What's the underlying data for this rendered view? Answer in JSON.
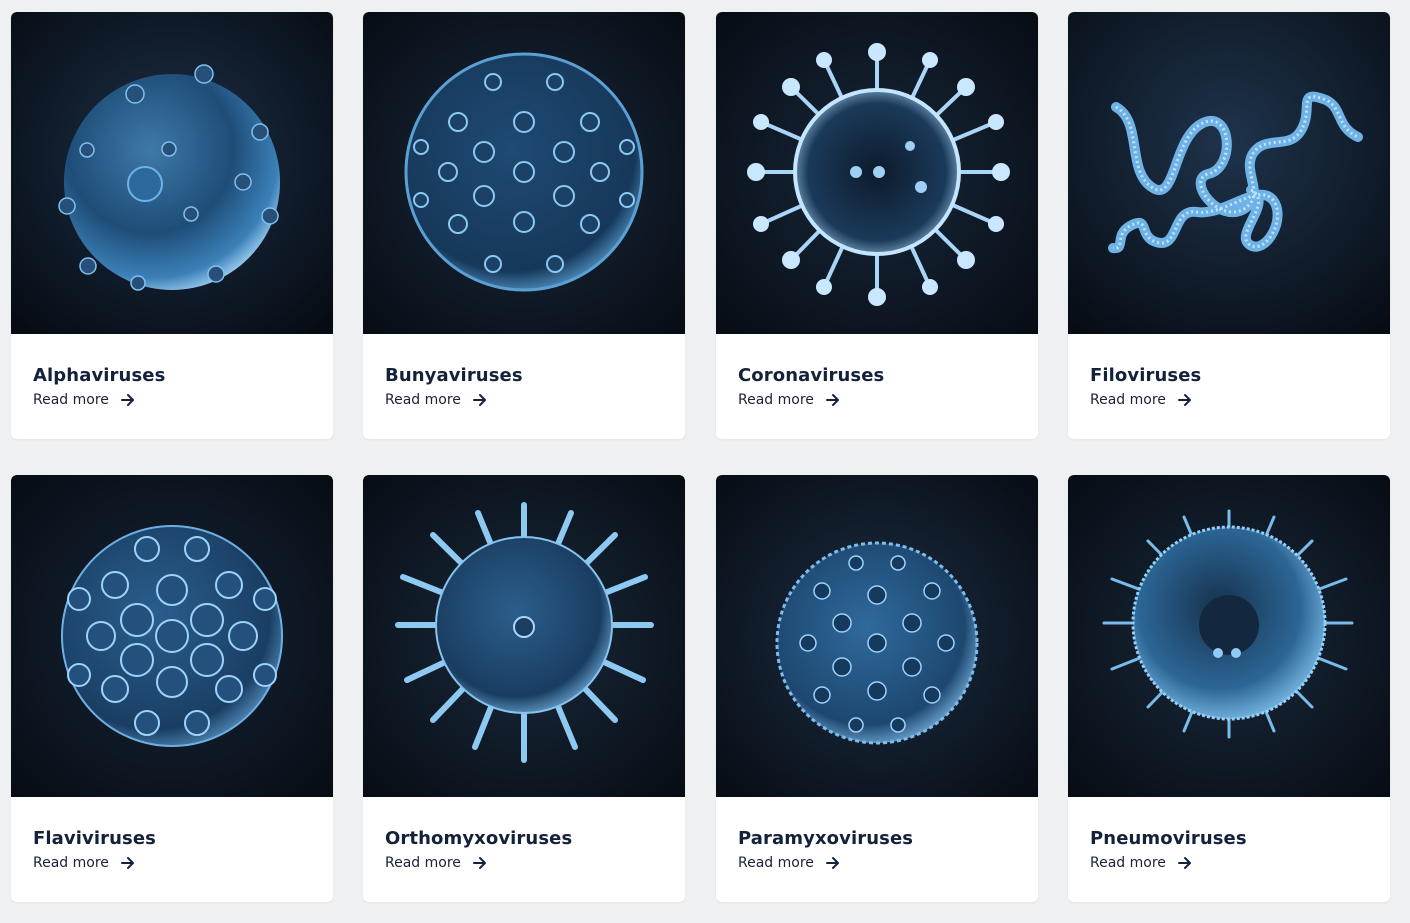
{
  "cards": [
    {
      "title": "Alphaviruses",
      "link_label": "Read more",
      "image_icon": "alphavirus-particle-icon"
    },
    {
      "title": "Bunyaviruses",
      "link_label": "Read more",
      "image_icon": "bunyavirus-particle-icon"
    },
    {
      "title": "Coronaviruses",
      "link_label": "Read more",
      "image_icon": "coronavirus-particle-icon"
    },
    {
      "title": "Filoviruses",
      "link_label": "Read more",
      "image_icon": "filovirus-filament-icon"
    },
    {
      "title": "Flaviviruses",
      "link_label": "Read more",
      "image_icon": "flavivirus-particle-icon"
    },
    {
      "title": "Orthomyxoviruses",
      "link_label": "Read more",
      "image_icon": "orthomyxovirus-particle-icon"
    },
    {
      "title": "Paramyxoviruses",
      "link_label": "Read more",
      "image_icon": "paramyxovirus-particle-icon"
    },
    {
      "title": "Pneumoviruses",
      "link_label": "Read more",
      "image_icon": "pneumovirus-particle-icon"
    }
  ],
  "colors": {
    "page_background": "#eff0f2",
    "card_background": "#ffffff",
    "image_background": "#0c1420",
    "virus_glow": "#6fb2e6",
    "title_text": "#14213a"
  }
}
